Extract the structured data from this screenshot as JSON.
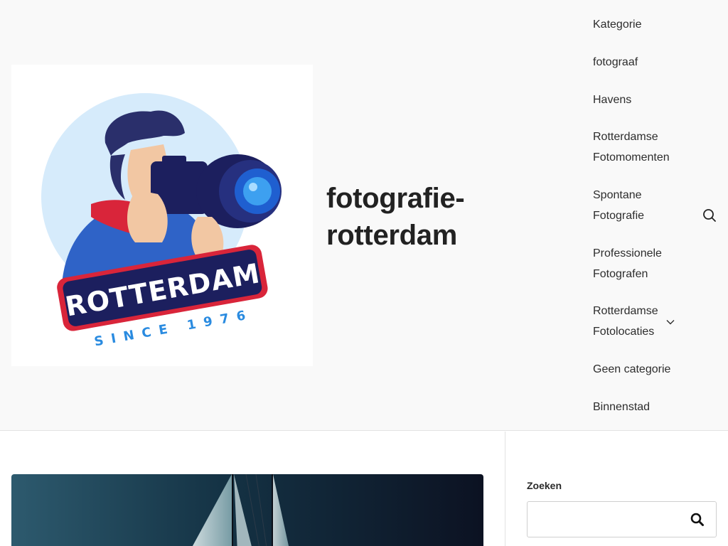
{
  "site": {
    "title": "fotografie-rotterdam",
    "logo": {
      "main_text": "ROTTERDAM",
      "sub_text": "SINCE 1976"
    }
  },
  "nav": {
    "items": [
      {
        "label": "Kategorie"
      },
      {
        "label": "fotograaf"
      },
      {
        "label": "Havens"
      },
      {
        "label": "Rotterdamse Fotomomenten"
      },
      {
        "label": "Spontane Fotografie"
      },
      {
        "label": "Professionele Fotografen"
      },
      {
        "label": "Rotterdamse Fotolocaties",
        "has_submenu": true
      },
      {
        "label": "Geen categorie"
      },
      {
        "label": "Binnenstad"
      }
    ]
  },
  "sidebar": {
    "search_widget": {
      "title": "Zoeken",
      "value": ""
    }
  },
  "colors": {
    "header_bg": "#f9f9f9",
    "text": "#2d2d2d",
    "logo_navy": "#1c1f5e",
    "logo_red": "#d9253a",
    "logo_blue": "#2a8be0",
    "logo_circle": "#d6ebfb"
  },
  "icons": {
    "header_search": "search-icon",
    "submenu": "chevron-down-icon",
    "widget_search": "search-icon"
  }
}
